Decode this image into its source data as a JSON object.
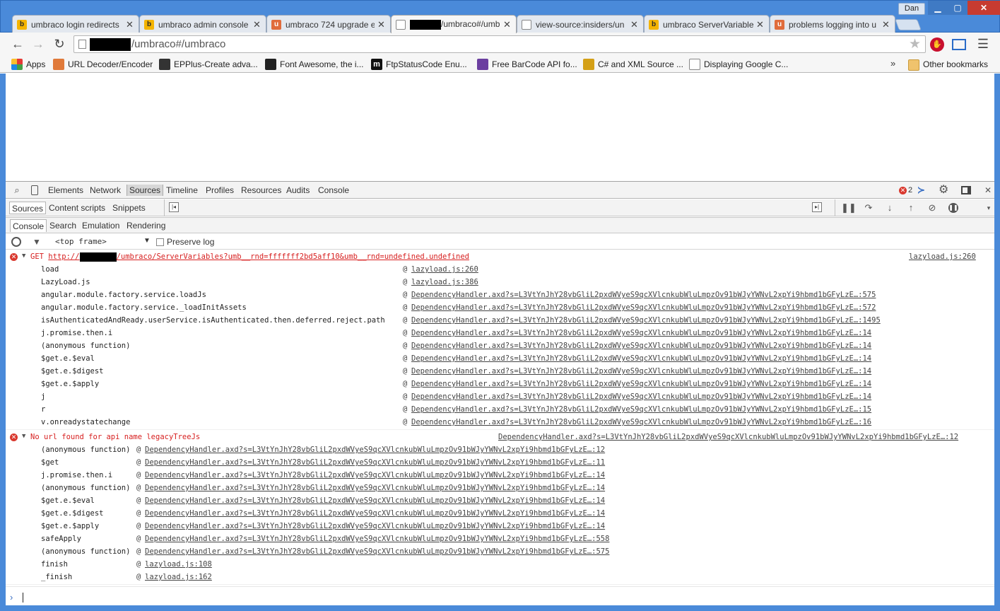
{
  "browser": {
    "user": "Dan",
    "tabs": [
      {
        "title": "umbraco login redirects",
        "icon": "bing"
      },
      {
        "title": "umbraco admin console",
        "icon": "bing"
      },
      {
        "title": "umbraco 724 upgrade e",
        "icon": "umbraco"
      },
      {
        "title": "/umbraco#/umb",
        "icon": "doc",
        "active": true
      },
      {
        "title": "view-source:insiders/un",
        "icon": "doc"
      },
      {
        "title": "umbraco ServerVariable",
        "icon": "bing"
      },
      {
        "title": "problems logging into u",
        "icon": "umbraco"
      }
    ],
    "address": "/umbraco#/umbraco",
    "bookmarks": [
      {
        "label": "Apps"
      },
      {
        "label": "URL Decoder/Encoder"
      },
      {
        "label": "EPPlus-Create adva..."
      },
      {
        "label": "Font Awesome, the i..."
      },
      {
        "label": "FtpStatusCode Enu..."
      },
      {
        "label": "Free BarCode API fo..."
      },
      {
        "label": "C# and XML Source ..."
      },
      {
        "label": "Displaying Google C..."
      }
    ],
    "bookmarks_overflow": "»",
    "other_bookmarks": "Other bookmarks"
  },
  "devtools": {
    "tabs": [
      "Elements",
      "Network",
      "Sources",
      "Timeline",
      "Profiles",
      "Resources",
      "Audits",
      "Console"
    ],
    "active_tab": "Sources",
    "error_count": "2",
    "source_tabs": [
      "Sources",
      "Content scripts",
      "Snippets"
    ],
    "drawer_tabs": [
      "Console",
      "Search",
      "Emulation",
      "Rendering"
    ],
    "frame_selector": "<top frame>",
    "preserve_log": "Preserve log",
    "console": {
      "error1": {
        "method": "GET",
        "url_prefix": "http://",
        "url_suffix": "/umbraco/ServerVariables?umb__rnd=fffffff2bd5aff10&umb__rnd=undefined.undefined",
        "source": "lazyload.js:260",
        "stack": [
          {
            "fn": "load",
            "src": "lazyload.js:260"
          },
          {
            "fn": "LazyLoad.js",
            "src": "lazyload.js:386"
          },
          {
            "fn": "angular.module.factory.service.loadJs",
            "src": "DependencyHandler.axd?s=L3VtYnJhY28vbGliL2pxdWVyeS9qcXVlcnkubWluLmpzOv91bWJyYWNvL2xpYi9hbmd1bGFyLzE…:575"
          },
          {
            "fn": "angular.module.factory.service._loadInitAssets",
            "src": "DependencyHandler.axd?s=L3VtYnJhY28vbGliL2pxdWVyeS9qcXVlcnkubWluLmpzOv91bWJyYWNvL2xpYi9hbmd1bGFyLzE…:572"
          },
          {
            "fn": "isAuthenticatedAndReady.userService.isAuthenticated.then.deferred.reject.path",
            "src": "DependencyHandler.axd?s=L3VtYnJhY28vbGliL2pxdWVyeS9qcXVlcnkubWluLmpzOv91bWJyYWNvL2xpYi9hbmd1bGFyLzE…:1495"
          },
          {
            "fn": "j.promise.then.i",
            "src": "DependencyHandler.axd?s=L3VtYnJhY28vbGliL2pxdWVyeS9qcXVlcnkubWluLmpzOv91bWJyYWNvL2xpYi9hbmd1bGFyLzE…:14"
          },
          {
            "fn": "(anonymous function)",
            "src": "DependencyHandler.axd?s=L3VtYnJhY28vbGliL2pxdWVyeS9qcXVlcnkubWluLmpzOv91bWJyYWNvL2xpYi9hbmd1bGFyLzE…:14"
          },
          {
            "fn": "$get.e.$eval",
            "src": "DependencyHandler.axd?s=L3VtYnJhY28vbGliL2pxdWVyeS9qcXVlcnkubWluLmpzOv91bWJyYWNvL2xpYi9hbmd1bGFyLzE…:14"
          },
          {
            "fn": "$get.e.$digest",
            "src": "DependencyHandler.axd?s=L3VtYnJhY28vbGliL2pxdWVyeS9qcXVlcnkubWluLmpzOv91bWJyYWNvL2xpYi9hbmd1bGFyLzE…:14"
          },
          {
            "fn": "$get.e.$apply",
            "src": "DependencyHandler.axd?s=L3VtYnJhY28vbGliL2pxdWVyeS9qcXVlcnkubWluLmpzOv91bWJyYWNvL2xpYi9hbmd1bGFyLzE…:14"
          },
          {
            "fn": "j",
            "src": "DependencyHandler.axd?s=L3VtYnJhY28vbGliL2pxdWVyeS9qcXVlcnkubWluLmpzOv91bWJyYWNvL2xpYi9hbmd1bGFyLzE…:14"
          },
          {
            "fn": "r",
            "src": "DependencyHandler.axd?s=L3VtYnJhY28vbGliL2pxdWVyeS9qcXVlcnkubWluLmpzOv91bWJyYWNvL2xpYi9hbmd1bGFyLzE…:15"
          },
          {
            "fn": "v.onreadystatechange",
            "src": "DependencyHandler.axd?s=L3VtYnJhY28vbGliL2pxdWVyeS9qcXVlcnkubWluLmpzOv91bWJyYWNvL2xpYi9hbmd1bGFyLzE…:16"
          }
        ]
      },
      "error2": {
        "message": "No url found for api name legacyTreeJs",
        "source": "DependencyHandler.axd?s=L3VtYnJhY28vbGliL2pxdWVyeS9qcXVlcnkubWluLmpzOv91bWJyYWNvL2xpYi9hbmd1bGFyLzE…:12",
        "stack": [
          {
            "fn": "(anonymous function)",
            "src": "DependencyHandler.axd?s=L3VtYnJhY28vbGliL2pxdWVyeS9qcXVlcnkubWluLmpzOv91bWJyYWNvL2xpYi9hbmd1bGFyLzE…:12"
          },
          {
            "fn": "$get",
            "src": "DependencyHandler.axd?s=L3VtYnJhY28vbGliL2pxdWVyeS9qcXVlcnkubWluLmpzOv91bWJyYWNvL2xpYi9hbmd1bGFyLzE…:11"
          },
          {
            "fn": "j.promise.then.i",
            "src": "DependencyHandler.axd?s=L3VtYnJhY28vbGliL2pxdWVyeS9qcXVlcnkubWluLmpzOv91bWJyYWNvL2xpYi9hbmd1bGFyLzE…:14"
          },
          {
            "fn": "(anonymous function)",
            "src": "DependencyHandler.axd?s=L3VtYnJhY28vbGliL2pxdWVyeS9qcXVlcnkubWluLmpzOv91bWJyYWNvL2xpYi9hbmd1bGFyLzE…:14"
          },
          {
            "fn": "$get.e.$eval",
            "src": "DependencyHandler.axd?s=L3VtYnJhY28vbGliL2pxdWVyeS9qcXVlcnkubWluLmpzOv91bWJyYWNvL2xpYi9hbmd1bGFyLzE…:14"
          },
          {
            "fn": "$get.e.$digest",
            "src": "DependencyHandler.axd?s=L3VtYnJhY28vbGliL2pxdWVyeS9qcXVlcnkubWluLmpzOv91bWJyYWNvL2xpYi9hbmd1bGFyLzE…:14"
          },
          {
            "fn": "$get.e.$apply",
            "src": "DependencyHandler.axd?s=L3VtYnJhY28vbGliL2pxdWVyeS9qcXVlcnkubWluLmpzOv91bWJyYWNvL2xpYi9hbmd1bGFyLzE…:14"
          },
          {
            "fn": "safeApply",
            "src": "DependencyHandler.axd?s=L3VtYnJhY28vbGliL2pxdWVyeS9qcXVlcnkubWluLmpzOv91bWJyYWNvL2xpYi9hbmd1bGFyLzE…:558"
          },
          {
            "fn": "(anonymous function)",
            "src": "DependencyHandler.axd?s=L3VtYnJhY28vbGliL2pxdWVyeS9qcXVlcnkubWluLmpzOv91bWJyYWNvL2xpYi9hbmd1bGFyLzE…:575"
          },
          {
            "fn": "finish",
            "src": "lazyload.js:108"
          },
          {
            "fn": "_finish",
            "src": "lazyload.js:162"
          }
        ]
      }
    }
  }
}
